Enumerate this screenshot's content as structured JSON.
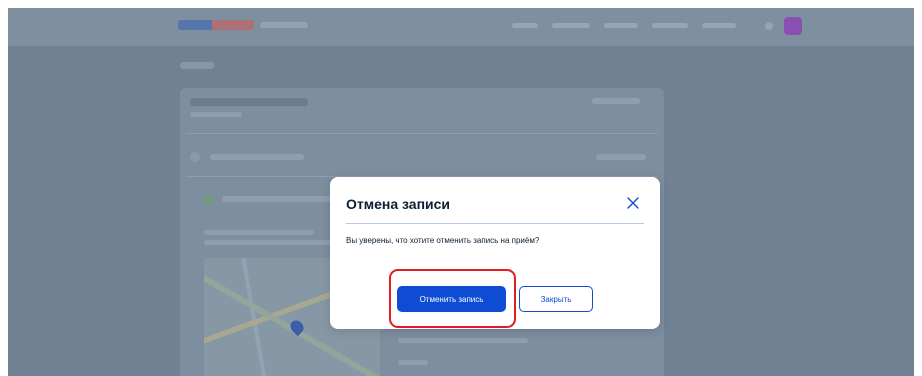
{
  "modal": {
    "title": "Отмена записи",
    "message": "Вы уверены, что хотите отменить запись на приём?",
    "confirm_label": "Отменить запись",
    "dismiss_label": "Закрыть",
    "close_icon": "close-icon"
  },
  "colors": {
    "overlay": "#6f8193",
    "primary": "#0d4cd3",
    "title_text": "#0b1f33",
    "divider": "#b7c9e6",
    "highlight": "#e31b23"
  }
}
